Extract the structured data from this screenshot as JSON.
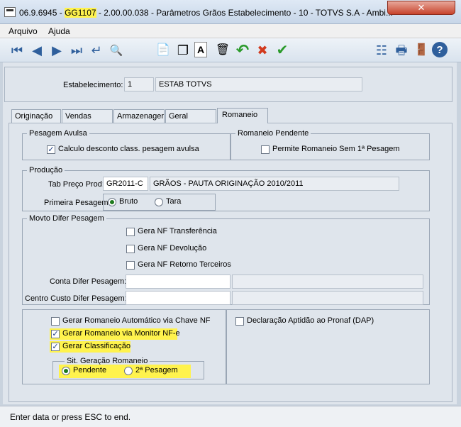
{
  "window": {
    "title_prefix": "06.9.6945 - ",
    "title_code": "GG1107",
    "title_suffix": " - 2.00.00.038 - Parâmetros Grãos Estabelecimento - 10 - TOTVS S.A - Ambi...",
    "close_glyph": "✕"
  },
  "menu": {
    "items": [
      "Arquivo",
      "Ajuda"
    ]
  },
  "toolbar": {
    "first": "⏮",
    "prev": "◀",
    "next": "▶",
    "last": "⏭",
    "goto": "↵",
    "search": "🔍",
    "new": "📄",
    "copy": "❐",
    "edit": "A",
    "delete": "🗑",
    "undo": "↶",
    "cancel": "✖",
    "save": "✔",
    "tree": "☷",
    "print": "🖶",
    "exit": "🚪",
    "help": "?"
  },
  "header": {
    "estab_label": "Estabelecimento:",
    "estab_code": "1",
    "estab_name": "ESTAB TOTVS"
  },
  "tabs": [
    "Originação",
    "Vendas",
    "Armazenager",
    "Geral",
    "Romaneio"
  ],
  "pesagem_avulsa": {
    "title": "Pesagem Avulsa",
    "calc_label": "Calculo desconto class. pesagem avulsa",
    "calc_checked": "✓"
  },
  "romaneio_pendente": {
    "title": "Romaneio Pendente",
    "permite_label": "Permite Romaneio Sem 1ª Pesagem"
  },
  "producao": {
    "title": "Produção",
    "tab_preco_label": "Tab Preço Prod:",
    "tab_preco_code": "GR2011-C",
    "tab_preco_desc": "GRÃOS - PAUTA ORIGINAÇÃO 2010/2011",
    "primeira_label": "Primeira Pesagem:",
    "bruto_label": "Bruto",
    "tara_label": "Tara"
  },
  "movto": {
    "title": "Movto Difer Pesagem",
    "nf_transf": "Gera NF Transferência",
    "nf_devol": "Gera NF Devolução",
    "nf_retorno": "Gera NF Retorno Terceiros",
    "conta_label": "Conta Difer Pesagem:",
    "centro_label": "Centro Custo Difer Pesagem:"
  },
  "romaneio_opts": {
    "auto_chave": "Gerar Romaneio Automático via Chave NF",
    "monitor": "Gerar Romaneio via Monitor NF-e",
    "classificacao": "Gerar Classificação",
    "checked_glyph": "✓",
    "sit_title": "Sit. Geração Romaneio",
    "pendente": "Pendente",
    "segunda": "2ª Pesagem"
  },
  "dap": {
    "label": "Declaração Aptidão ao Pronaf (DAP)"
  },
  "status": {
    "text": "Enter data or press ESC to end."
  },
  "colors": {
    "highlight": "#fff34d",
    "accent": "#2f5f9c"
  }
}
